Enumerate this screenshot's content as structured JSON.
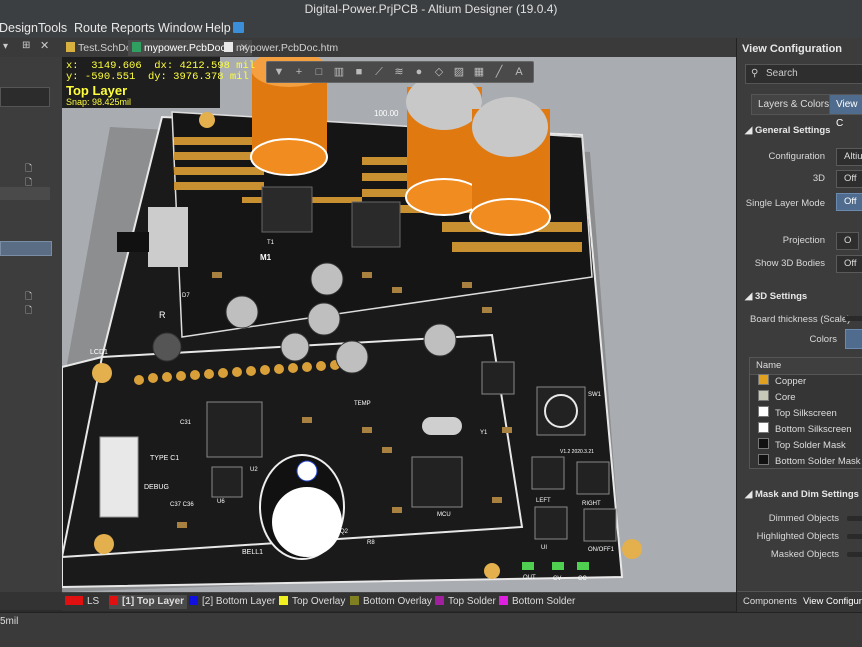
{
  "window": {
    "title": "Digital-Power.PrjPCB - Altium Designer (19.0.4)"
  },
  "menu": {
    "items": [
      "Design",
      "Tools",
      "Route",
      "Reports",
      "Window",
      "Help"
    ]
  },
  "doc_tabs": [
    {
      "label": "Test.SchDoc",
      "active": false
    },
    {
      "label": "mypower.PcbDoc *",
      "active": true
    },
    {
      "label": "mypower.PcbDoc.htm",
      "active": false
    }
  ],
  "coords": {
    "x_label": "x:",
    "x_value": "3149.606",
    "dx_label": "dx:",
    "dx_value": "4212.598 mil",
    "y_label": "y:",
    "y_value": "-590.551",
    "dy_label": "dy:",
    "dy_value": "3976.378 mil",
    "layer": "Top Layer",
    "snap": "Snap: 98.425mil"
  },
  "toolbar_icons": [
    "filter-icon",
    "plus-icon",
    "rect-select-icon",
    "chart-icon",
    "component-icon",
    "route-icon",
    "bus-icon",
    "place-pad-icon",
    "polygon-icon",
    "region-icon",
    "measure-icon",
    "line-icon",
    "text-icon"
  ],
  "right_panel": {
    "title": "View Configuration",
    "search_placeholder": "Search",
    "tabs": [
      "Layers & Colors",
      "View C"
    ],
    "general_header": "General Settings",
    "configuration_label": "Configuration",
    "configuration_value": "Altium",
    "label_3d": "3D",
    "value_3d": "Off",
    "single_layer_label": "Single Layer Mode",
    "single_layer_value": "Off",
    "projection_label": "Projection",
    "projection_value": "O",
    "show3d_label": "Show 3D Bodies",
    "show3d_value": "Off",
    "settings3d_header": "3D Settings",
    "thickness_label": "Board thickness (Scale)",
    "colors_label": "Colors",
    "table_header": "Name",
    "layers": [
      {
        "name": "Copper",
        "color": "#e0a020"
      },
      {
        "name": "Core",
        "color": "#c8c8b8"
      },
      {
        "name": "Top Silkscreen",
        "color": "#ffffff"
      },
      {
        "name": "Bottom Silkscreen",
        "color": "#ffffff"
      },
      {
        "name": "Top Solder Mask",
        "color": "#111111"
      },
      {
        "name": "Bottom Solder Mask",
        "color": "#111111"
      }
    ],
    "mask_header": "Mask and Dim Settings",
    "dimmed_label": "Dimmed Objects",
    "highlighted_label": "Highlighted Objects",
    "masked_label": "Masked Objects",
    "bottom_tabs": [
      "Components",
      "View Configura"
    ]
  },
  "layer_tabs": [
    {
      "label": "LS",
      "color": "#e01010"
    },
    {
      "label": "[1] Top Layer",
      "color": "#e01010",
      "active": true
    },
    {
      "label": "[2] Bottom Layer",
      "color": "#1010e0"
    },
    {
      "label": "Top Overlay",
      "color": "#f0f020"
    },
    {
      "label": "Bottom Overlay",
      "color": "#808020"
    },
    {
      "label": "Top Solder",
      "color": "#a020a0"
    },
    {
      "label": "Bottom Solder",
      "color": "#e020e0"
    }
  ],
  "status": {
    "text": "5mil"
  },
  "pcb_labels": {
    "lcd": "LCD1",
    "type_c": "TYPE C1",
    "debug": "DEBUG",
    "bell": "BELL1",
    "u6": "U6",
    "u2": "U2",
    "mcu": "MCU",
    "temp": "TEMP",
    "y1": "Y1",
    "left": "LEFT",
    "right": "RIGHT",
    "on_off": "ON/OFF1",
    "out": "OUT",
    "cv": "CV",
    "cc": "CC",
    "sw": "SW1",
    "m1": "M1",
    "t1": "T1",
    "dim": "100.00",
    "c31": "C31",
    "c37": "C37 C36",
    "ui": "UI",
    "d7": "D7",
    "r": "R",
    "rev": "V1.2 2020.3.21",
    "u1": "U1",
    "q2": "Q2",
    "r8": "R8"
  }
}
